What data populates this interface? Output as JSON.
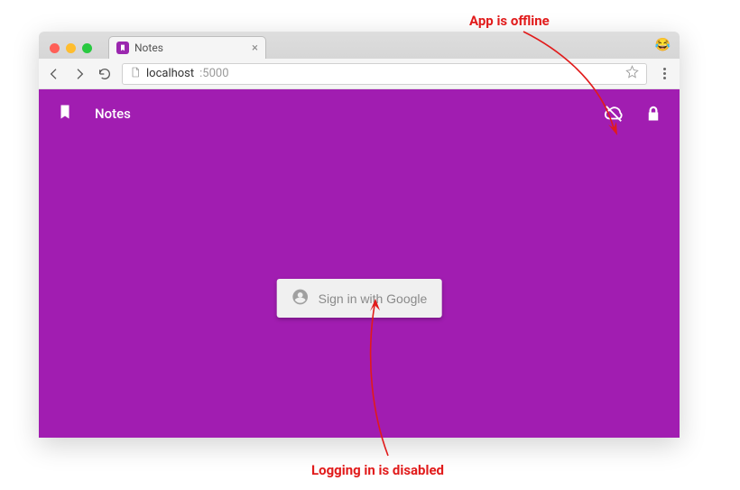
{
  "browser": {
    "tab_title": "Notes",
    "url_host": "localhost",
    "url_port": ":5000"
  },
  "app": {
    "title": "Notes",
    "signin_label": "Sign in with Google"
  },
  "annotations": {
    "offline": "App is offline",
    "login_disabled": "Logging in is disabled"
  }
}
